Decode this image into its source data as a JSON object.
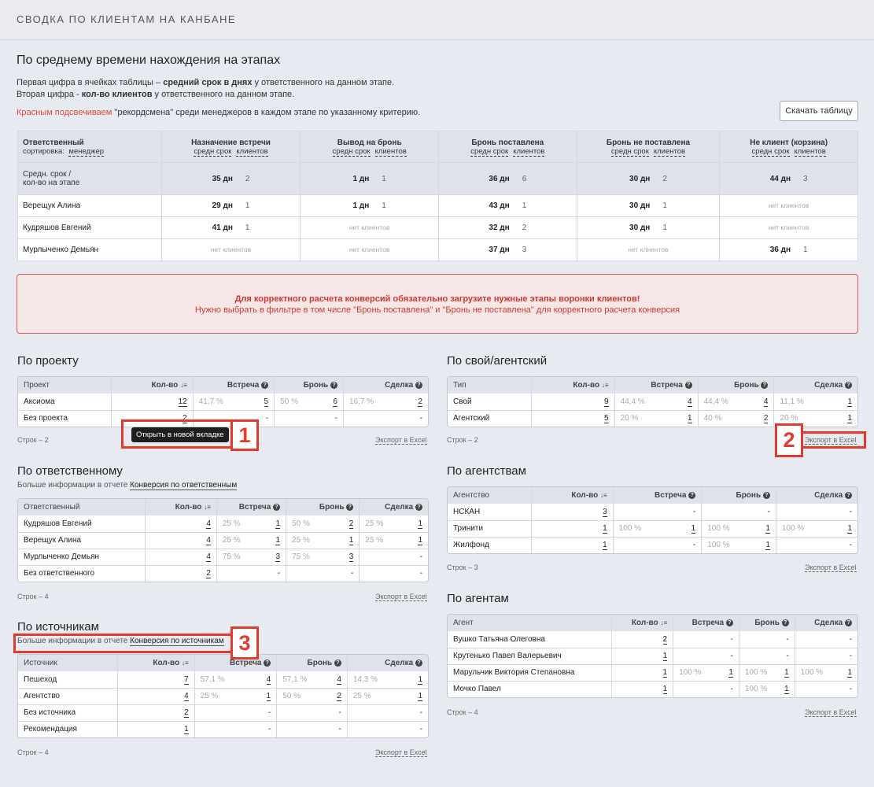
{
  "header": {
    "title": "СВОДКА ПО КЛИЕНТАМ НА КАНБАНЕ"
  },
  "stages": {
    "title": "По среднему времени нахождения на этапах",
    "line1_a": "Первая цифра в ячейках таблицы – ",
    "line1_b": "средний срок в днях",
    "line1_c": " у ответственного на данном этапе.",
    "line2_a": "Вторая цифра - ",
    "line2_b": "кол-во клиентов",
    "line2_c": " у ответственного на данном этапе.",
    "line3_a": "Красным подсвечиваем",
    "line3_b": " \"рекордсмена\" среди менеджеров в каждом этапе по указанному критерию.",
    "download": "Скачать таблицу",
    "col0": "Ответственный",
    "sort_label": "сортировка:",
    "sort_value": "менеджер",
    "sub_a": "средн срок",
    "sub_b": "клиентов",
    "cols": [
      "Назначение встречи",
      "Вывод на бронь",
      "Бронь поставлена",
      "Бронь не поставлена",
      "Не клиент (корзина)"
    ],
    "avg_label1": "Средн. срок /",
    "avg_label2": "кол-во на этапе",
    "avg": [
      [
        "35 дн",
        "2"
      ],
      [
        "1 дн",
        "1"
      ],
      [
        "36 дн",
        "6"
      ],
      [
        "30 дн",
        "2"
      ],
      [
        "44 дн",
        "3"
      ]
    ],
    "no_clients": "нет клиентов",
    "rows": [
      {
        "name": "Верещук Алина",
        "c": [
          [
            "29 дн",
            "1"
          ],
          [
            "1 дн",
            "1"
          ],
          [
            "43 дн",
            "1"
          ],
          [
            "30 дн",
            "1"
          ],
          null
        ]
      },
      {
        "name": "Кудряшов Евгений",
        "c": [
          [
            "41 дн",
            "1"
          ],
          null,
          [
            "32 дн",
            "2"
          ],
          [
            "30 дн",
            "1"
          ],
          null
        ]
      },
      {
        "name": "Мурлыченко Демьян",
        "c": [
          null,
          null,
          [
            "37 дн",
            "3"
          ],
          null,
          [
            "36 дн",
            "1"
          ]
        ]
      }
    ]
  },
  "alert": {
    "line1": "Для корректного расчета конверсий обязательно загрузите нужные этапы воронки клиентов!",
    "line2": "Нужно выбрать в фильтре в том числе \"Бронь поставлена\" и \"Бронь не поставлена\" для корректного расчета конверсия"
  },
  "common": {
    "qty": "Кол-во",
    "meeting": "Встреча",
    "booking": "Бронь",
    "deal": "Сделка",
    "export": "Экспорт в Excel",
    "more": "Больше информации в отчете",
    "dash": "-"
  },
  "project": {
    "title": "По проекту",
    "col": "Проект",
    "rows_text": "Строк – 2",
    "rows": [
      {
        "name": "Аксиома",
        "q": "12",
        "m": [
          "41,7 %",
          "5"
        ],
        "b": [
          "50 %",
          "6"
        ],
        "d": [
          "16,7 %",
          "2"
        ]
      },
      {
        "name": "Без проекта",
        "q": "2",
        "m": null,
        "b": null,
        "d": null
      }
    ]
  },
  "own": {
    "title": "По свой/агентский",
    "col": "Тип",
    "rows_text": "Строк – 2",
    "rows": [
      {
        "name": "Свой",
        "q": "9",
        "m": [
          "44,4 %",
          "4"
        ],
        "b": [
          "44,4 %",
          "4"
        ],
        "d": [
          "11,1 %",
          "1"
        ]
      },
      {
        "name": "Агентский",
        "q": "5",
        "m": [
          "20 %",
          "1"
        ],
        "b": [
          "40 %",
          "2"
        ],
        "d": [
          "20 %",
          "1"
        ]
      }
    ]
  },
  "resp": {
    "title": "По ответственному",
    "link": "Конверсия по ответственным",
    "col": "Ответственный",
    "rows_text": "Строк – 4",
    "rows": [
      {
        "name": "Кудряшов Евгений",
        "q": "4",
        "m": [
          "25 %",
          "1"
        ],
        "b": [
          "50 %",
          "2"
        ],
        "d": [
          "25 %",
          "1"
        ]
      },
      {
        "name": "Верещук Алина",
        "q": "4",
        "m": [
          "25 %",
          "1"
        ],
        "b": [
          "25 %",
          "1"
        ],
        "d": [
          "25 %",
          "1"
        ]
      },
      {
        "name": "Мурлыченко Демьян",
        "q": "4",
        "m": [
          "75 %",
          "3"
        ],
        "b": [
          "75 %",
          "3"
        ],
        "d": null
      },
      {
        "name": "Без ответственного",
        "q": "2",
        "m": null,
        "b": null,
        "d": null
      }
    ]
  },
  "agency": {
    "title": "По агентствам",
    "col": "Агентство",
    "rows_text": "Строк – 3",
    "rows": [
      {
        "name": "НСКАН",
        "q": "3",
        "m": null,
        "b": null,
        "d": null
      },
      {
        "name": "Тринити",
        "q": "1",
        "m": [
          "100 %",
          "1"
        ],
        "b": [
          "100 %",
          "1"
        ],
        "d": [
          "100 %",
          "1"
        ]
      },
      {
        "name": "Жилфонд",
        "q": "1",
        "m": null,
        "b": [
          "100 %",
          "1"
        ],
        "d": null
      }
    ]
  },
  "source": {
    "title": "По источникам",
    "link": "Конверсия по источникам",
    "col": "Источник",
    "rows_text": "Строк – 4",
    "rows": [
      {
        "name": "Пешеход",
        "q": "7",
        "m": [
          "57,1 %",
          "4"
        ],
        "b": [
          "57,1 %",
          "4"
        ],
        "d": [
          "14,3 %",
          "1"
        ]
      },
      {
        "name": "Агентство",
        "q": "4",
        "m": [
          "25 %",
          "1"
        ],
        "b": [
          "50 %",
          "2"
        ],
        "d": [
          "25 %",
          "1"
        ]
      },
      {
        "name": "Без источника",
        "q": "2",
        "m": null,
        "b": null,
        "d": null
      },
      {
        "name": "Рекомендация",
        "q": "1",
        "m": null,
        "b": null,
        "d": null
      }
    ]
  },
  "agents": {
    "title": "По агентам",
    "col": "Агент",
    "rows_text": "Строк – 4",
    "rows": [
      {
        "name": "Вушко Татьяна Олеговна",
        "q": "2",
        "m": null,
        "b": null,
        "d": null
      },
      {
        "name": "Крутенько Павел Валерьевич",
        "q": "1",
        "m": null,
        "b": null,
        "d": null
      },
      {
        "name": "Марульчик Виктория Степановна",
        "q": "1",
        "m": [
          "100 %",
          "1"
        ],
        "b": [
          "100 %",
          "1"
        ],
        "d": [
          "100 %",
          "1"
        ]
      },
      {
        "name": "Мочко Павел",
        "q": "1",
        "m": null,
        "b": [
          "100 %",
          "1"
        ],
        "d": null
      }
    ]
  },
  "tooltip": "Открыть в новой вкладке",
  "markers": [
    "1",
    "2",
    "3"
  ],
  "colors": {
    "accent_red": "#e0463c",
    "marker_red": "#e23b2e"
  }
}
